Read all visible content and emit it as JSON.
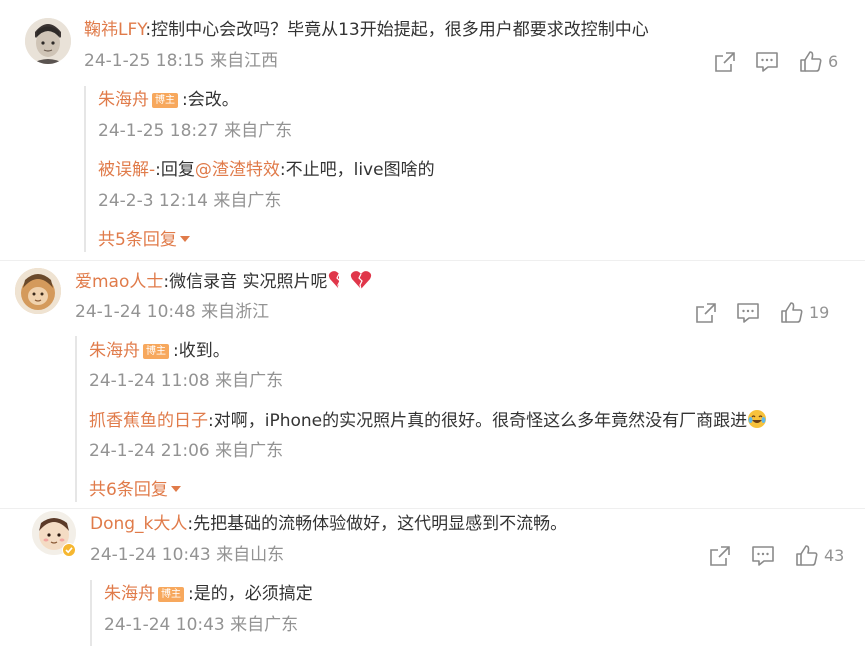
{
  "comments": [
    {
      "user": "鞠祎LFY",
      "text": ":控制中心会改吗？毕竟从13开始提起，很多用户都要求改控制中心",
      "meta": "24-1-25 18:15 来自江西",
      "like_count": "6",
      "replies": [
        {
          "user": "朱海舟",
          "badge": "博主",
          "text": ":会改。",
          "meta": "24-1-25 18:27 来自广东"
        },
        {
          "user": "被误解-",
          "text_prefix": ":回复",
          "mention": "@渣渣特效",
          "text": ":不止吧，live图啥的",
          "meta": "24-2-3 12:14 来自广东"
        }
      ],
      "more_replies": "共5条回复"
    },
    {
      "user": "爱mao人士",
      "text": ":微信录音 实况照片呢",
      "meta": "24-1-24 10:48 来自浙江",
      "like_count": "19",
      "replies": [
        {
          "user": "朱海舟",
          "badge": "博主",
          "text": ":收到。",
          "meta": "24-1-24 11:08 来自广东"
        },
        {
          "user": "抓香蕉鱼的日子",
          "text": ":对啊，iPhone的实况照片真的很好。很奇怪这么多年竟然没有厂商跟进",
          "meta": "24-1-24 21:06 来自广东"
        }
      ],
      "more_replies": "共6条回复"
    },
    {
      "user": "Dong_k大人",
      "text": ":先把基础的流畅体验做好，这代明显感到不流畅。",
      "meta": "24-1-24 10:43 来自山东",
      "like_count": "43",
      "replies": [
        {
          "user": "朱海舟",
          "badge": "博主",
          "text": ":是的，必须搞定",
          "meta": "24-1-24 10:43 来自广东"
        }
      ]
    }
  ],
  "icons": {
    "share": "share-icon",
    "comment": "comment-icon",
    "like": "thumbs-up-icon",
    "heart": "broken-heart-emoji",
    "laugh": "laugh-cry-emoji",
    "verified": "verified-badge-icon"
  },
  "colors": {
    "username": "#e07b4a",
    "meta": "#939393",
    "badge": "#f7a85d",
    "text": "#333333"
  }
}
